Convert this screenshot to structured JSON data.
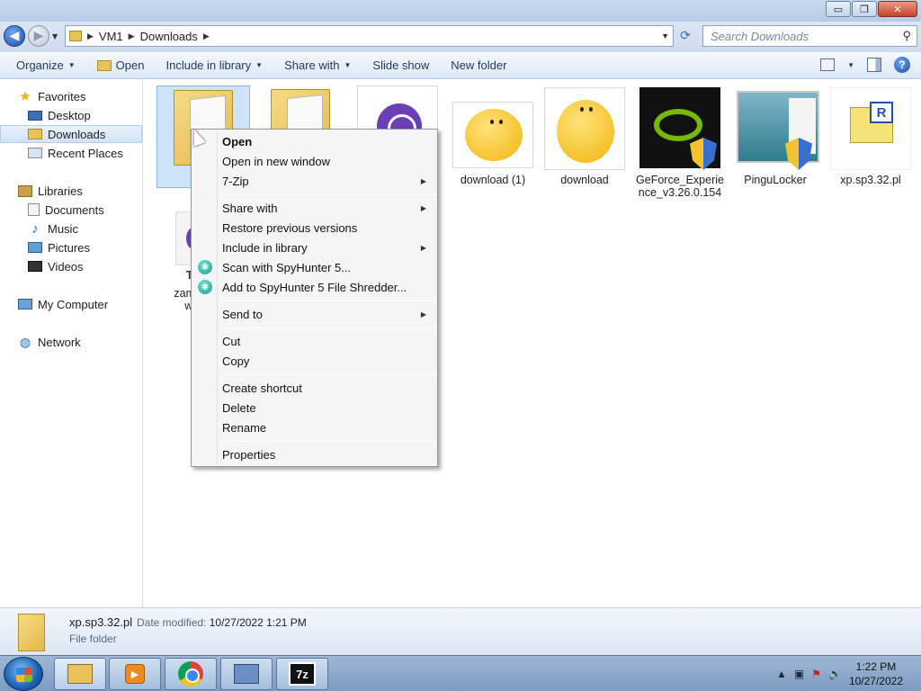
{
  "window": {
    "min_label": "▭",
    "max_label": "❐",
    "close_label": "✕"
  },
  "address": {
    "crumbs": [
      "VM1",
      "Downloads"
    ],
    "search_placeholder": "Search Downloads"
  },
  "toolbar": {
    "organize": "Organize",
    "open": "Open",
    "include_in_library": "Include in library",
    "share_with": "Share with",
    "slide_show": "Slide show",
    "new_folder": "New folder"
  },
  "nav": {
    "favorites": "Favorites",
    "desktop": "Desktop",
    "downloads": "Downloads",
    "recent_places": "Recent Places",
    "libraries": "Libraries",
    "documents": "Documents",
    "music": "Music",
    "pictures": "Pictures",
    "videos": "Videos",
    "my_computer": "My Computer",
    "network": "Network"
  },
  "files": {
    "f1": "xp.",
    "f5": "download (1)",
    "f6": "download",
    "f7": "GeForce_Experience_v3.26.0.154",
    "f8": "PinguLocker",
    "f9": "xp.sp3.32.pl",
    "f10_line1": "TO",
    "f10_line2": "zama",
    "f10_line3": "wla"
  },
  "context_menu": {
    "open": "Open",
    "open_new_window": "Open in new window",
    "seven_zip": "7-Zip",
    "share_with": "Share with",
    "restore_previous": "Restore previous versions",
    "include_in_library": "Include in library",
    "scan_spyhunter": "Scan with SpyHunter 5...",
    "add_spyhunter": "Add to SpyHunter 5 File Shredder...",
    "send_to": "Send to",
    "cut": "Cut",
    "copy": "Copy",
    "create_shortcut": "Create shortcut",
    "delete": "Delete",
    "rename": "Rename",
    "properties": "Properties"
  },
  "details": {
    "name": "xp.sp3.32.pl",
    "modified_label": "Date modified:",
    "modified_value": "10/27/2022 1:21 PM",
    "type": "File folder"
  },
  "taskbar": {
    "seven_zip_label": "7z",
    "time": "1:22 PM",
    "date": "10/27/2022"
  }
}
